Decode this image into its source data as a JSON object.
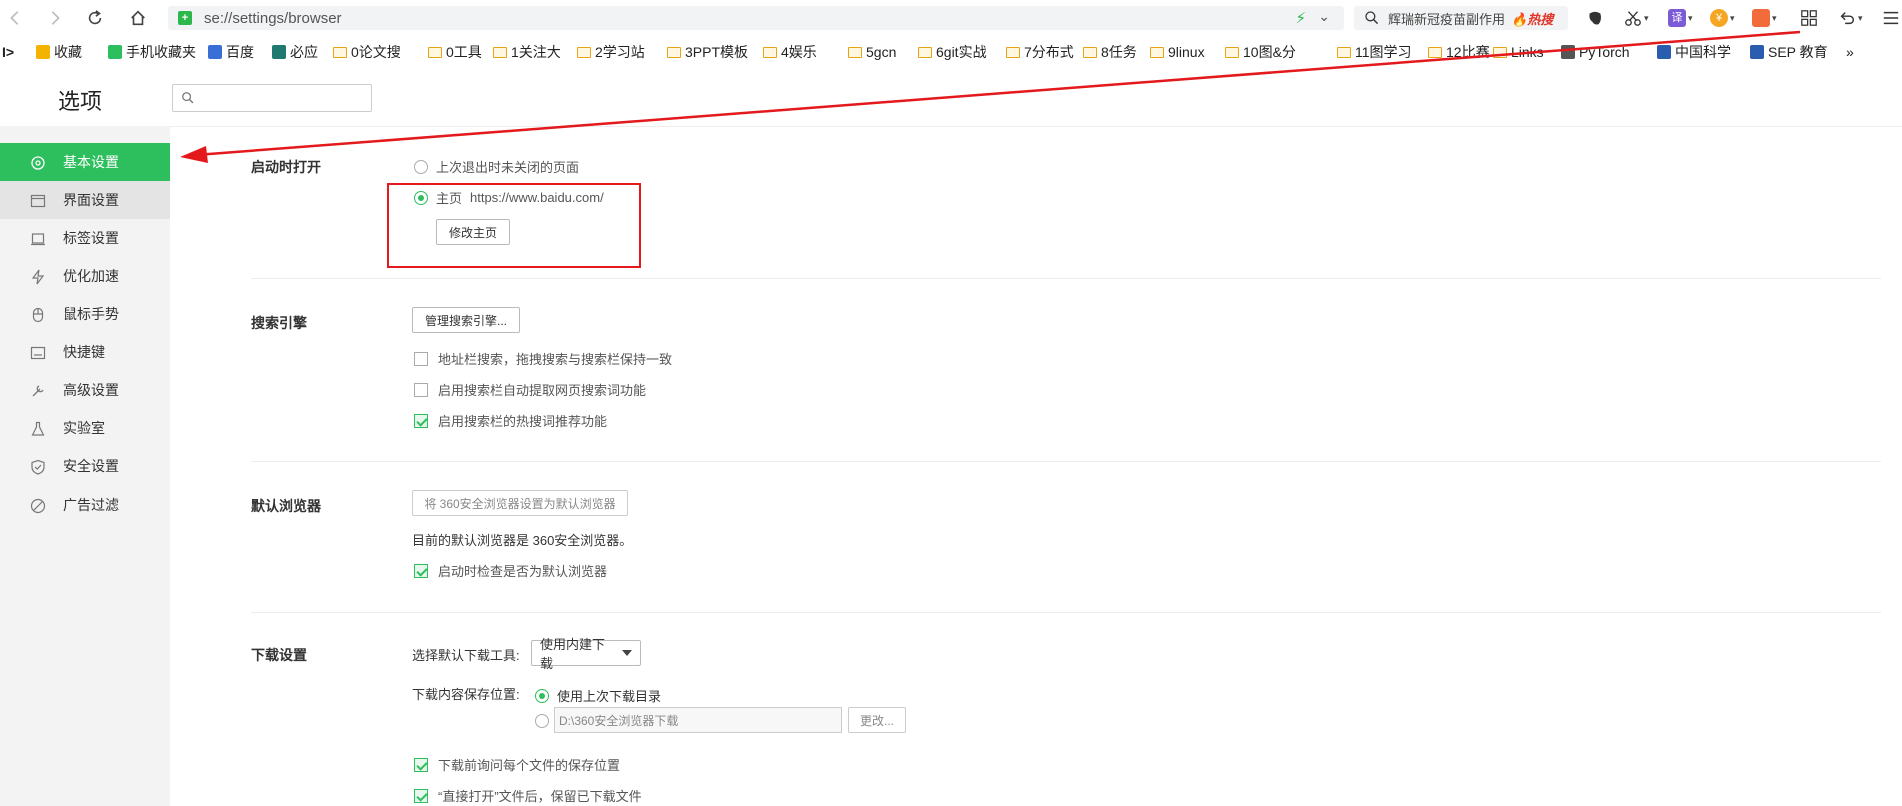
{
  "toolbar": {
    "url": "se://settings/browser",
    "search_text": "辉瑞新冠疫苗副作用",
    "search_hot": "🔥热搜"
  },
  "bookmarks": [
    {
      "label": "收藏",
      "type": "star"
    },
    {
      "label": "手机收藏夹",
      "type": "phone"
    },
    {
      "label": "百度",
      "type": "baidu"
    },
    {
      "label": "必应",
      "type": "bing"
    },
    {
      "label": "0论文搜",
      "type": "folder"
    },
    {
      "label": "0工具",
      "type": "folder"
    },
    {
      "label": "1关注大",
      "type": "folder"
    },
    {
      "label": "2学习站",
      "type": "folder"
    },
    {
      "label": "3PPT模板",
      "type": "folder"
    },
    {
      "label": "4娱乐",
      "type": "folder"
    },
    {
      "label": "5gcn",
      "type": "folder"
    },
    {
      "label": "6git实战",
      "type": "folder"
    },
    {
      "label": "7分布式",
      "type": "folder"
    },
    {
      "label": "8任务",
      "type": "folder"
    },
    {
      "label": "9linux",
      "type": "folder"
    },
    {
      "label": "10图&分",
      "type": "folder"
    },
    {
      "label": "11图学习",
      "type": "folder"
    },
    {
      "label": "12比赛",
      "type": "folder"
    },
    {
      "label": "Links",
      "type": "folder"
    },
    {
      "label": "PyTorch",
      "type": "page"
    },
    {
      "label": "中国科学",
      "type": "mail"
    },
    {
      "label": "SEP 教育",
      "type": "sep"
    }
  ],
  "bookmarks_more": "»",
  "header": {
    "title": "选项",
    "search_placeholder": ""
  },
  "sidebar": {
    "items": [
      {
        "label": "基本设置",
        "icon": "target-icon",
        "active": true
      },
      {
        "label": "界面设置",
        "icon": "window-icon"
      },
      {
        "label": "标签设置",
        "icon": "tab-icon"
      },
      {
        "label": "优化加速",
        "icon": "bolt-icon"
      },
      {
        "label": "鼠标手势",
        "icon": "mouse-icon"
      },
      {
        "label": "快捷键",
        "icon": "keyboard-icon"
      },
      {
        "label": "高级设置",
        "icon": "tools-icon"
      },
      {
        "label": "实验室",
        "icon": "flask-icon"
      },
      {
        "label": "安全设置",
        "icon": "shield-icon"
      },
      {
        "label": "广告过滤",
        "icon": "ban-icon"
      }
    ]
  },
  "startup": {
    "title": "启动时打开",
    "option_last": "上次退出时未关闭的页面",
    "option_home": "主页",
    "home_url": "https://www.baidu.com/",
    "modify_button": "修改主页"
  },
  "search_engine": {
    "title": "搜索引擎",
    "manage_button": "管理搜索引擎...",
    "opt1": "地址栏搜索，拖拽搜索与搜索栏保持一致",
    "opt2": "启用搜索栏自动提取网页搜索词功能",
    "opt3": "启用搜索栏的热搜词推荐功能"
  },
  "default_browser": {
    "title": "默认浏览器",
    "set_button": "将 360安全浏览器设置为默认浏览器",
    "status": "目前的默认浏览器是 360安全浏览器。",
    "check_opt": "启动时检查是否为默认浏览器"
  },
  "download": {
    "title": "下载设置",
    "tool_label": "选择默认下载工具:",
    "tool_value": "使用内建下载",
    "location_label": "下载内容保存位置:",
    "use_last": "使用上次下载目录",
    "path": "D:\\360安全浏览器下载",
    "change_button": "更改...",
    "ask_each": "下载前询问每个文件的保存位置",
    "keep_after_open": "“直接打开”文件后，保留已下载文件"
  },
  "colors": {
    "accent": "#2dbe5d",
    "annotation": "#e4191b"
  }
}
